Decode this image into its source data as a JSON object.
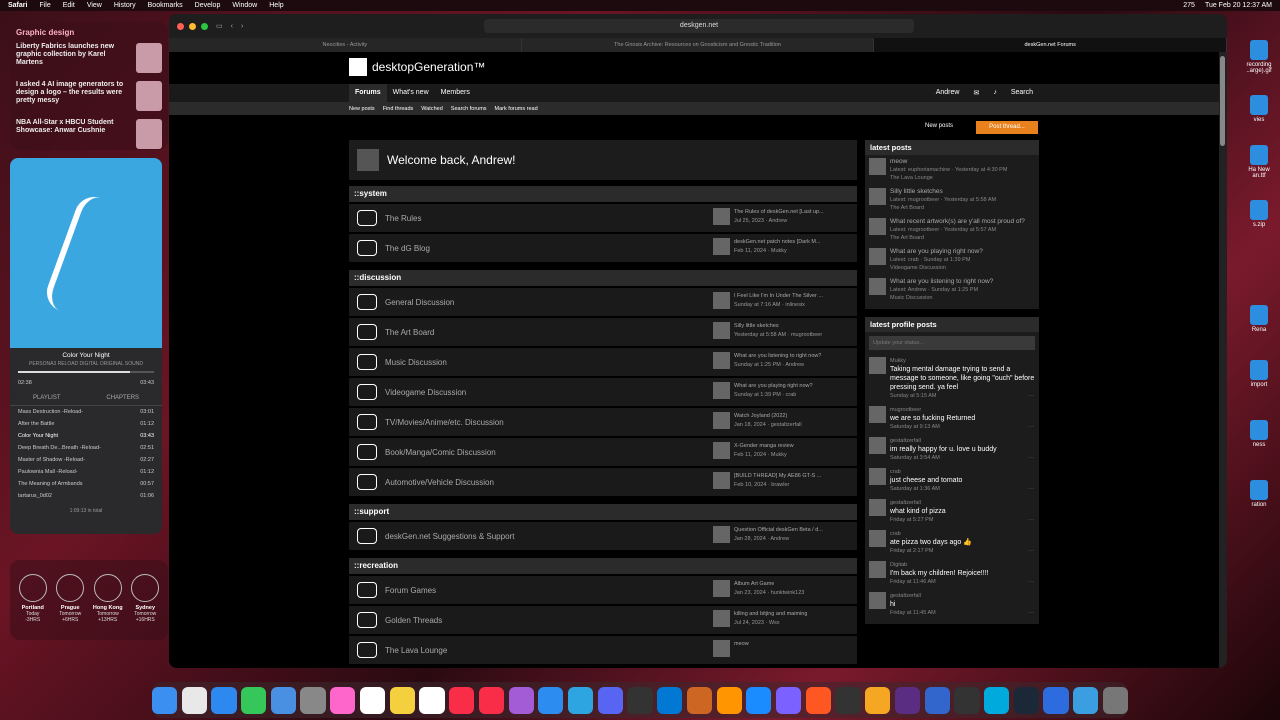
{
  "menubar": {
    "app": "Safari",
    "items": [
      "File",
      "Edit",
      "View",
      "History",
      "Bookmarks",
      "Develop",
      "Window",
      "Help"
    ],
    "counter": "275",
    "clock": "Tue Feb 20  12:37 AM"
  },
  "news": {
    "title": "Graphic design",
    "items": [
      "Liberty Fabrics launches new graphic collection by Karel Martens",
      "I asked 4 AI image generators to design a logo – the results were pretty messy",
      "NBA All-Star x HBCU Student Showcase: Anwar Cushnie"
    ]
  },
  "music": {
    "now_playing": "Color Your Night",
    "album": "PERSONA3 RELOAD DIGITAL ORIGINAL SOUND",
    "time_elapsed": "02:38",
    "time_left": "03:43",
    "tab_playlist": "PLAYLIST",
    "tab_chapters": "CHAPTERS",
    "tracks": [
      {
        "name": "Mass Destruction -Reload-",
        "dur": "03:01"
      },
      {
        "name": "After the Battle",
        "dur": "01:12"
      },
      {
        "name": "Color Your Night",
        "dur": "03:43"
      },
      {
        "name": "Deep Breath De...Breath -Reload-",
        "dur": "02:51"
      },
      {
        "name": "Master of Shadow -Reload-",
        "dur": "02:27"
      },
      {
        "name": "Paulownia Mall -Reload-",
        "dur": "01:12"
      },
      {
        "name": "The Meaning of Armbands",
        "dur": "00:57"
      },
      {
        "name": "tartarus_0d02",
        "dur": "01:06"
      }
    ],
    "total": "1:09:13 in total"
  },
  "clocks": [
    {
      "city": "Portland",
      "day": "Today",
      "off": "-3HRS"
    },
    {
      "city": "Prague",
      "day": "Tomorrow",
      "off": "+6HRS"
    },
    {
      "city": "Hong Kong",
      "day": "Tomorrow",
      "off": "+13HRS"
    },
    {
      "city": "Sydney",
      "day": "Tomorrow",
      "off": "+16HRS"
    }
  ],
  "browser": {
    "url": "deskgen.net",
    "tabs": [
      "Neocities - Activity",
      "The Gnosis Archive: Resources on Gnosticism and Gnostic Tradition",
      "deskGen.net Forums"
    ]
  },
  "site": {
    "logo": "desktopGeneration™",
    "nav": [
      "Forums",
      "What's new",
      "Members"
    ],
    "user": "Andrew",
    "search": "Search",
    "subnav": [
      "New posts",
      "Find threads",
      "Watched",
      "Search forums",
      "Mark forums read"
    ],
    "new_posts": "New posts",
    "post_thread": "Post thread...",
    "welcome": "Welcome back, Andrew!"
  },
  "categories": [
    {
      "title": "::system",
      "nodes": [
        {
          "name": "The Rules",
          "last": "The Rules of deskGen.net [Last up...",
          "meta": "Jul 25, 2023 · Andrew"
        },
        {
          "name": "The dG Blog",
          "last": "deskGen.net patch notes [Dark M...",
          "meta": "Feb 11, 2024 · Mukky"
        }
      ]
    },
    {
      "title": "::discussion",
      "nodes": [
        {
          "name": "General Discussion",
          "last": "I Feel Like I'm In Under The Silver ...",
          "meta": "Sunday at 7:16 AM · inlinesix"
        },
        {
          "name": "The Art Board",
          "last": "Silly little sketches",
          "meta": "Yesterday at 5:58 AM · mugrootbeer"
        },
        {
          "name": "Music Discussion",
          "last": "What are you listening to right now?",
          "meta": "Sunday at 1:25 PM · Andrew"
        },
        {
          "name": "Videogame Discussion",
          "last": "What are you playing right now?",
          "meta": "Sunday at 1:39 PM · crab"
        },
        {
          "name": "TV/Movies/Anime/etc. Discussion",
          "last": "Watch Joyland (2022)",
          "meta": "Jan 18, 2024 · gestaltzerfall"
        },
        {
          "name": "Book/Manga/Comic Discussion",
          "last": "X-Gender manga review",
          "meta": "Feb 11, 2024 · Mukky"
        },
        {
          "name": "Automotive/Vehicle Discussion",
          "last": "[BUILD THREAD] My AE86 GT-S ...",
          "meta": "Feb 10, 2024 · brawler"
        }
      ]
    },
    {
      "title": "::support",
      "nodes": [
        {
          "name": "deskGen.net Suggestions & Support",
          "last": "Question Official deskGen Beta / d...",
          "meta": "Jan 28, 2024 · Andrew"
        }
      ]
    },
    {
      "title": "::recreation",
      "nodes": [
        {
          "name": "Forum Games",
          "last": "Album Art Game",
          "meta": "Jan 23, 2024 · hunktwink123"
        },
        {
          "name": "Golden Threads",
          "last": "killing and bitjing and maiming",
          "meta": "Jul 24, 2023 · Wsx"
        },
        {
          "name": "The Lava Lounge",
          "last": "meow",
          "meta": ""
        }
      ]
    }
  ],
  "latest_posts": {
    "title": "latest posts",
    "items": [
      {
        "t": "meow",
        "m": "Latest: euphoriamachine · Yesterday at 4:30 PM",
        "f": "The Lava Lounge"
      },
      {
        "t": "Silly little sketches",
        "m": "Latest: mugrootbeer · Yesterday at 5:58 AM",
        "f": "The Art Board"
      },
      {
        "t": "What recent artwork(s) are y'all most proud of?",
        "m": "Latest: mugrootbeer · Yesterday at 5:57 AM",
        "f": "The Art Board"
      },
      {
        "t": "What are you playing right now?",
        "m": "Latest: crab · Sunday at 1:39 PM",
        "f": "Videogame Discussion"
      },
      {
        "t": "What are you listening to right now?",
        "m": "Latest: Andrew · Sunday at 1:25 PM",
        "f": "Music Discussion"
      }
    ]
  },
  "profile_posts": {
    "title": "latest profile posts",
    "placeholder": "Update your status...",
    "items": [
      {
        "u": "Mukky",
        "b": "Taking mental damage trying to send a message to someone, like going \"ouch\" before pressing send. ya feel",
        "d": "Sunday at 5:15 AM"
      },
      {
        "u": "mugrootbeer",
        "b": "we are so fucking Returned",
        "d": "Saturday at 9:13 AM"
      },
      {
        "u": "gestaltzerfall",
        "b": "im really happy for u. love u buddy",
        "d": "Saturday at 3:54 AM"
      },
      {
        "u": "crab",
        "b": "just cheese and tomato",
        "d": "Saturday at 1:36 AM"
      },
      {
        "u": "gestaltzerfall",
        "b": "what kind of pizza",
        "d": "Friday at 5:27 PM"
      },
      {
        "u": "crab",
        "b": "ate pizza two days ago 👍",
        "d": "Friday at 2:17 PM"
      },
      {
        "u": "Digitab",
        "b": "I'm back my children! Rejoice!!!!",
        "d": "Friday at 11:46 AM"
      },
      {
        "u": "gestaltzerfall",
        "b": "hi",
        "d": "Friday at 11:45 AM"
      }
    ]
  },
  "desktop": [
    "recording ..arge).gif",
    "vies",
    "Ha New an.ttf",
    "s.zip",
    "Rena",
    "import",
    "ness",
    "ration"
  ],
  "dock_colors": [
    "#3b8ff0",
    "#e8e8e8",
    "#2d89f0",
    "#35c759",
    "#4a90e2",
    "#888",
    "#f6c",
    "#fff",
    "#f4d03f",
    "#fff",
    "#fa2d48",
    "#fa2d48",
    "#a35bd6",
    "#2d8cf0",
    "#2ca5e0",
    "#5865f2",
    "#333",
    "#0078d4",
    "#c62",
    "#ff9500",
    "#1a8cff",
    "#7b61ff",
    "#ff5722",
    "#333",
    "#f5a623",
    "#5a2d82",
    "#36c",
    "#333",
    "#0ad",
    "#1b2838",
    "#2d6cdf",
    "#3a9ee0",
    "#777"
  ]
}
